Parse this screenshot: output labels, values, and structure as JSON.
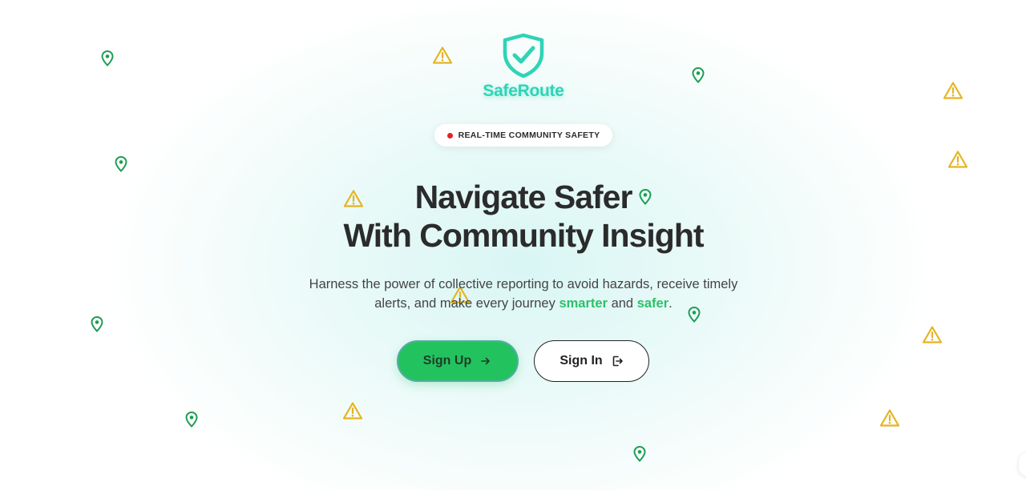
{
  "brand": {
    "name": "SafeRoute",
    "color": "#2ed4b6"
  },
  "badge": {
    "label": "REAL-TIME COMMUNITY SAFETY",
    "dot_color": "#e02424"
  },
  "hero": {
    "headline_line1": "Navigate Safer",
    "headline_line2": "With Community Insight",
    "sub_part1": "Harness the power of collective reporting to avoid hazards, receive timely alerts, and make every journey ",
    "sub_highlight1": "smarter",
    "sub_part2": " and ",
    "sub_highlight2": "safer",
    "sub_part3": ".",
    "highlight_color": "#2ec06a"
  },
  "actions": {
    "sign_up_label": "Sign Up",
    "sign_up_icon": "arrow-right-icon",
    "sign_in_label": "Sign In",
    "sign_in_icon": "login-icon",
    "primary_color": "#22c35e"
  },
  "decorations": {
    "pin_icon": "map-pin-icon",
    "pin_color": "#1f9d55",
    "warning_icon": "warning-triangle-icon",
    "warning_color": "#e6b422"
  }
}
